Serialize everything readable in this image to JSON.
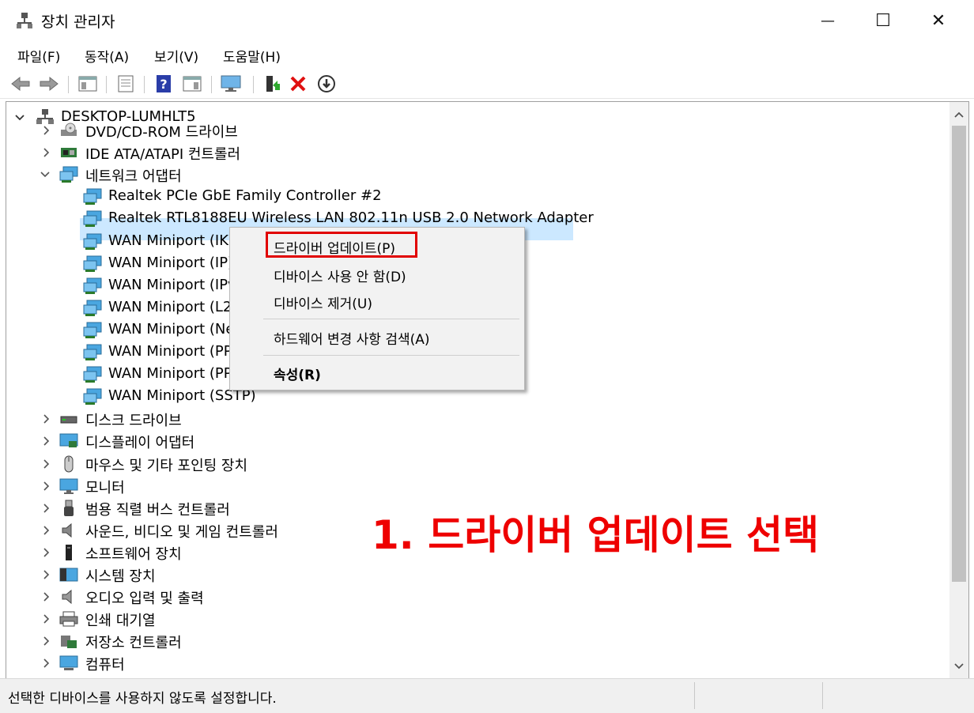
{
  "window": {
    "title": "장치 관리자",
    "minimize_glyph": "—",
    "maximize_glyph": "☐",
    "close_glyph": "✕"
  },
  "menu": [
    "파일(F)",
    "동작(A)",
    "보기(V)",
    "도움말(H)"
  ],
  "toolbar": {
    "icons": [
      "back-arrow-icon",
      "forward-arrow-icon",
      "show-hide-tree-icon",
      "properties-icon",
      "help-icon",
      "action-pane-icon",
      "monitor-icon",
      "update-driver-icon",
      "uninstall-icon",
      "download-icon"
    ]
  },
  "tree": {
    "root": "DESKTOP-LUMHLT5",
    "categories": [
      {
        "label": "DVD/CD-ROM 드라이브",
        "icon": "dvd-drive-icon",
        "expanded": false
      },
      {
        "label": "IDE ATA/ATAPI 컨트롤러",
        "icon": "ide-controller-icon",
        "expanded": false
      },
      {
        "label": "네트워크 어댑터",
        "icon": "network-adapter-icon",
        "expanded": true
      }
    ],
    "network_children": [
      "Realtek PCIe GbE Family Controller #2",
      "Realtek RTL8188EU Wireless LAN 802.11n USB 2.0 Network Adapter",
      "WAN Miniport (IKI",
      "WAN Miniport (IP)",
      "WAN Miniport (IPv",
      "WAN Miniport (L2",
      "WAN Miniport (Ne",
      "WAN Miniport (PP",
      "WAN Miniport (PP",
      "WAN Miniport (SSTP)"
    ],
    "other_categories": [
      {
        "label": "디스크 드라이브",
        "icon": "disk-drive-icon"
      },
      {
        "label": "디스플레이 어댑터",
        "icon": "display-adapter-icon"
      },
      {
        "label": "마우스 및 기타 포인팅 장치",
        "icon": "mouse-icon"
      },
      {
        "label": "모니터",
        "icon": "monitor-device-icon"
      },
      {
        "label": "범용 직렬 버스 컨트롤러",
        "icon": "usb-controller-icon"
      },
      {
        "label": "사운드, 비디오 및 게임 컨트롤러",
        "icon": "speaker-icon"
      },
      {
        "label": "소프트웨어 장치",
        "icon": "software-device-icon"
      },
      {
        "label": "시스템 장치",
        "icon": "system-device-icon"
      },
      {
        "label": "오디오 입력 및 출력",
        "icon": "audio-io-icon"
      },
      {
        "label": "인쇄 대기열",
        "icon": "printer-icon"
      },
      {
        "label": "저장소 컨트롤러",
        "icon": "storage-controller-icon"
      },
      {
        "label": "컴퓨터",
        "icon": "computer-icon"
      }
    ]
  },
  "context_menu": {
    "update_driver": "드라이버 업데이트(P)",
    "disable_device": "디바이스 사용 안 함(D)",
    "uninstall_device": "디바이스 제거(U)",
    "scan_hardware": "하드웨어 변경 사항 검색(A)",
    "properties": "속성(R)"
  },
  "annotation": "1. 드라이버 업데이트 선택",
  "status": "선택한 디바이스를 사용하지 않도록 설정합니다.",
  "colors": {
    "selection": "#cce8ff",
    "annotation_red": "#ee0000",
    "highlight_border": "#e10000"
  }
}
